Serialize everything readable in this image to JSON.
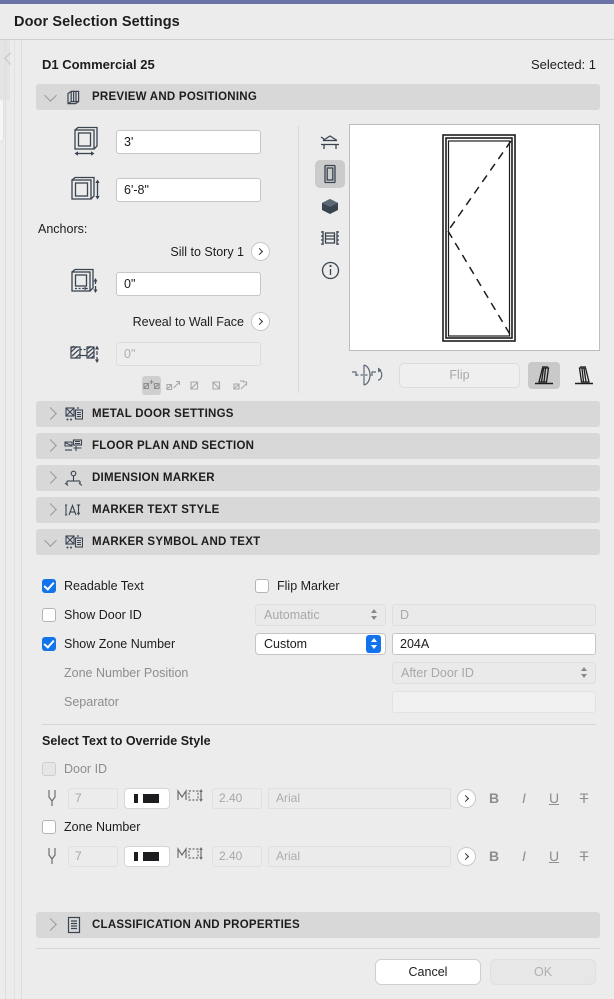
{
  "window": {
    "title": "Door Selection Settings"
  },
  "object": {
    "name": "D1 Commercial 25",
    "selected": "Selected: 1"
  },
  "sections": [
    {
      "id": "preview",
      "label": "PREVIEW AND POSITIONING",
      "icon": "book-3d-icon",
      "open": true
    },
    {
      "id": "metal",
      "label": "METAL DOOR SETTINGS",
      "icon": "door-settings-icon",
      "open": false
    },
    {
      "id": "floorplan",
      "label": "FLOOR PLAN AND SECTION",
      "icon": "floor-plan-icon",
      "open": false
    },
    {
      "id": "dimension",
      "label": "DIMENSION MARKER",
      "icon": "dimension-marker-icon",
      "open": false
    },
    {
      "id": "markertext",
      "label": "MARKER TEXT STYLE",
      "icon": "marker-text-style-icon",
      "open": false
    },
    {
      "id": "markersymbol",
      "label": "MARKER SYMBOL AND TEXT",
      "icon": "marker-symbol-icon",
      "open": true
    },
    {
      "id": "classification",
      "label": "CLASSIFICATION AND PROPERTIES",
      "icon": "document-list-icon",
      "open": false
    }
  ],
  "positioning": {
    "width_value": "3'",
    "width_icon": "door-width-icon",
    "height_value": "6'-8\"",
    "height_icon": "door-height-icon",
    "anchors_label": "Anchors:",
    "sill_label": "Sill to Story 1",
    "sill_value": "0\"",
    "sill_icon": "sill-anchor-icon",
    "reveal_label": "Reveal to Wall Face",
    "reveal_value": "0\"",
    "reveal_icon": "reveal-anchor-icon",
    "anchor_toggles": [
      {
        "name": "anchor-center",
        "selected": true
      },
      {
        "name": "anchor-left-edge",
        "selected": false
      },
      {
        "name": "anchor-left-corner",
        "selected": false
      },
      {
        "name": "anchor-right-corner",
        "selected": false
      },
      {
        "name": "anchor-both",
        "selected": false
      }
    ]
  },
  "preview": {
    "view_icons": [
      {
        "name": "elevation-view-icon",
        "selected": false
      },
      {
        "name": "door-front-view-icon",
        "selected": true
      },
      {
        "name": "3d-view-icon",
        "selected": false
      },
      {
        "name": "section-view-icon",
        "selected": false
      },
      {
        "name": "info-view-icon",
        "selected": false
      }
    ],
    "mirror_icon": "mirror-door-icon",
    "flip_label": "Flip",
    "swing_options": [
      {
        "name": "swing-left-icon",
        "selected": true
      },
      {
        "name": "swing-right-icon",
        "selected": false
      }
    ]
  },
  "marker": {
    "readable_text": {
      "label": "Readable Text",
      "checked": true
    },
    "flip_marker": {
      "label": "Flip Marker",
      "checked": false
    },
    "show_door_id": {
      "label": "Show Door ID",
      "checked": false
    },
    "door_id_mode": "Automatic",
    "door_id_value": "D",
    "show_zone_number": {
      "label": "Show Zone Number",
      "checked": true
    },
    "zone_mode": "Custom",
    "zone_value": "204A",
    "zone_position_label": "Zone Number Position",
    "zone_position_value": "After Door ID",
    "separator_label": "Separator",
    "separator_value": "",
    "override_title": "Select Text to Override Style",
    "override_rows": [
      {
        "label": "Door ID",
        "checked": false,
        "pen": "7",
        "size": "2.40",
        "font": "Arial",
        "bold": "B",
        "italic": "I",
        "underline": "U",
        "strike": "T"
      },
      {
        "label": "Zone Number",
        "checked": false,
        "pen": "7",
        "size": "2.40",
        "font": "Arial",
        "bold": "B",
        "italic": "I",
        "underline": "U",
        "strike": "T"
      }
    ]
  },
  "footer": {
    "cancel": "Cancel",
    "ok": "OK"
  },
  "colors": {
    "accent": "#6b73a8",
    "checkbox": "#1373eb",
    "section_bg": "#d8d8d8",
    "panel_bg": "#ececec"
  }
}
